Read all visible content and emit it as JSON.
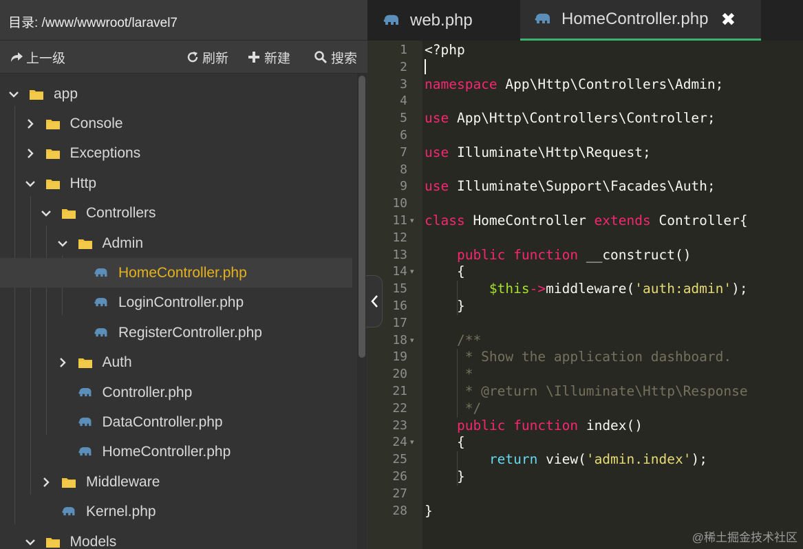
{
  "sidebar": {
    "path_label": "目录: /www/wwwroot/laravel7",
    "toolbar": {
      "up_label": "上一级",
      "refresh_label": "刷新",
      "new_label": "新建",
      "search_label": "搜索"
    },
    "tree": [
      {
        "label": "app",
        "type": "folder",
        "state": "expanded",
        "depth": 0
      },
      {
        "label": "Console",
        "type": "folder",
        "state": "collapsed",
        "depth": 1
      },
      {
        "label": "Exceptions",
        "type": "folder",
        "state": "collapsed",
        "depth": 1
      },
      {
        "label": "Http",
        "type": "folder",
        "state": "expanded",
        "depth": 1
      },
      {
        "label": "Controllers",
        "type": "folder",
        "state": "expanded",
        "depth": 2
      },
      {
        "label": "Admin",
        "type": "folder",
        "state": "expanded",
        "depth": 3
      },
      {
        "label": "HomeController.php",
        "type": "file",
        "depth": 4,
        "active": true
      },
      {
        "label": "LoginController.php",
        "type": "file",
        "depth": 4
      },
      {
        "label": "RegisterController.php",
        "type": "file",
        "depth": 4
      },
      {
        "label": "Auth",
        "type": "folder",
        "state": "collapsed",
        "depth": 3
      },
      {
        "label": "Controller.php",
        "type": "file",
        "depth": 3
      },
      {
        "label": "DataController.php",
        "type": "file",
        "depth": 3
      },
      {
        "label": "HomeController.php",
        "type": "file",
        "depth": 3
      },
      {
        "label": "Middleware",
        "type": "folder",
        "state": "collapsed",
        "depth": 2
      },
      {
        "label": "Kernel.php",
        "type": "file",
        "depth": 2
      },
      {
        "label": "Models",
        "type": "folder",
        "state": "expanded",
        "depth": 1
      }
    ]
  },
  "tabs": [
    {
      "label": "web.php",
      "active": false
    },
    {
      "label": "HomeController.php",
      "active": true,
      "close": "✖"
    }
  ],
  "editor": {
    "lines": [
      {
        "n": "1",
        "text": "<?php"
      },
      {
        "n": "2",
        "text": ""
      },
      {
        "n": "3",
        "text": "namespace App\\Http\\Controllers\\Admin;"
      },
      {
        "n": "4",
        "text": ""
      },
      {
        "n": "5",
        "text": "use App\\Http\\Controllers\\Controller;"
      },
      {
        "n": "6",
        "text": ""
      },
      {
        "n": "7",
        "text": "use Illuminate\\Http\\Request;"
      },
      {
        "n": "8",
        "text": ""
      },
      {
        "n": "9",
        "text": "use Illuminate\\Support\\Facades\\Auth;"
      },
      {
        "n": "10",
        "text": ""
      },
      {
        "n": "11",
        "text": "class HomeController extends Controller{",
        "fold": true
      },
      {
        "n": "12",
        "text": ""
      },
      {
        "n": "13",
        "text": "    public function __construct()"
      },
      {
        "n": "14",
        "text": "    {",
        "fold": true
      },
      {
        "n": "15",
        "text": "        $this->middleware('auth:admin');"
      },
      {
        "n": "16",
        "text": "    }"
      },
      {
        "n": "17",
        "text": ""
      },
      {
        "n": "18",
        "text": "    /**",
        "fold": true
      },
      {
        "n": "19",
        "text": "     * Show the application dashboard."
      },
      {
        "n": "20",
        "text": "     *"
      },
      {
        "n": "21",
        "text": "     * @return \\Illuminate\\Http\\Response"
      },
      {
        "n": "22",
        "text": "     */"
      },
      {
        "n": "23",
        "text": "    public function index()"
      },
      {
        "n": "24",
        "text": "    {",
        "fold": true
      },
      {
        "n": "25",
        "text": "        return view('admin.index');"
      },
      {
        "n": "26",
        "text": "    }"
      },
      {
        "n": "27",
        "text": ""
      },
      {
        "n": "28",
        "text": "}"
      }
    ]
  },
  "watermark": "@稀土掘金技术社区",
  "colors": {
    "keyword": "#f92672",
    "function_kw": "#66d9ef",
    "string": "#e6db74",
    "variable": "#a6e22e",
    "comment": "#75715e",
    "active_file": "#e5b21d",
    "folder": "#f0c33c",
    "php_icon": "#5b8fb9",
    "tab_accent": "#3cb371"
  },
  "icons": {
    "up": "arrow-up-right-icon",
    "refresh": "refresh-icon",
    "new": "plus-icon",
    "search": "search-icon",
    "folder": "folder-icon",
    "php": "php-elephant-icon",
    "collapse": "chevron-left-icon"
  }
}
